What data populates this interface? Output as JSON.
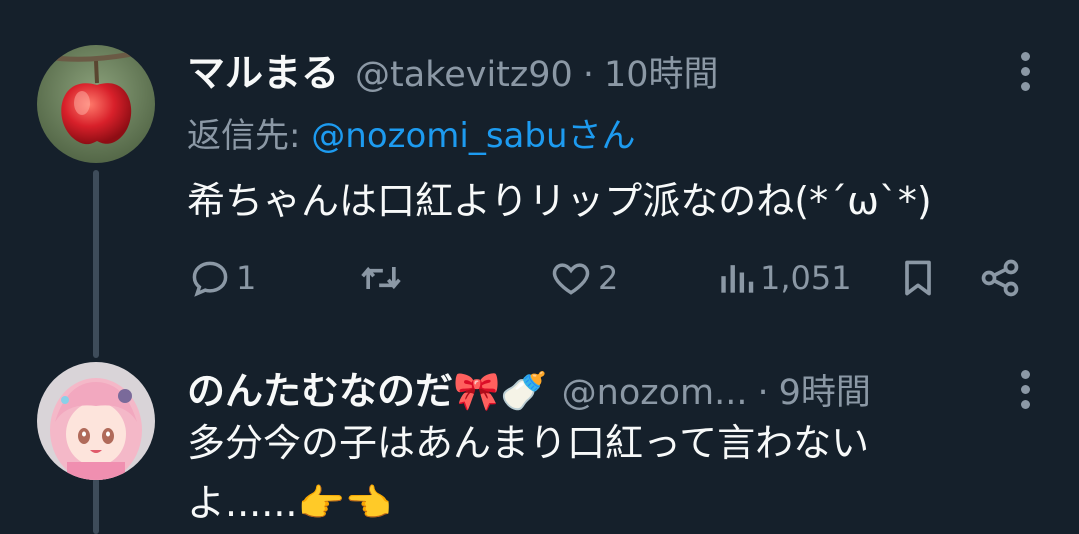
{
  "tweets": [
    {
      "display_name": "マルまる",
      "handle": "@takevitz90",
      "separator": "·",
      "time": "10時間",
      "replying_prefix": "返信先:",
      "replying_to": "@nozomi_sabuさん",
      "text": "希ちゃんは口紅よりリップ派なのね(*´ω`*)",
      "actions": {
        "reply_count": "1",
        "retweet_count": "",
        "like_count": "2",
        "view_count": "1,051"
      },
      "avatar_icon": "apple-avatar"
    },
    {
      "display_name": "のんたむなのだ🎀🍼",
      "handle": "@nozom...",
      "separator": "·",
      "time": "9時間",
      "text_line1": "多分今の子はあんまり口紅って言わない",
      "text_line2": "よ......👉👈",
      "avatar_icon": "anime-girl-avatar"
    }
  ],
  "colors": {
    "background": "#15202b",
    "text": "#f7f9f9",
    "muted": "#8b98a5",
    "link": "#1d9bf0",
    "thread_line": "#3e4c5a"
  }
}
